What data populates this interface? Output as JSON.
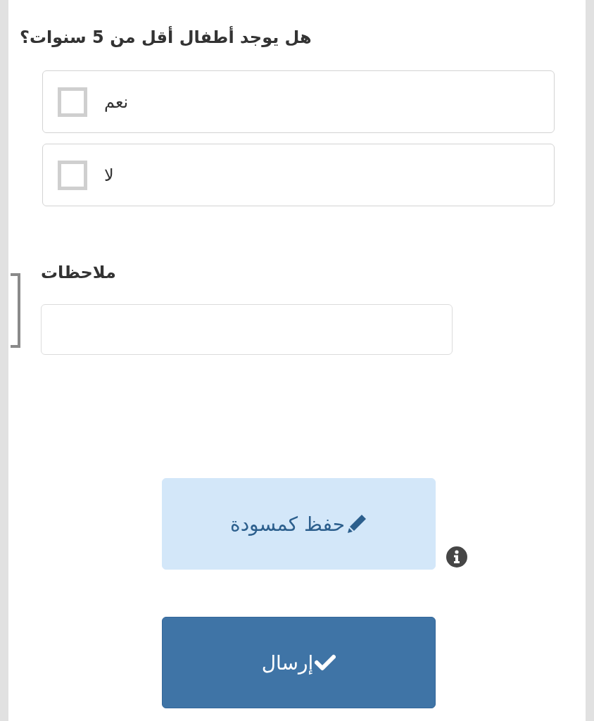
{
  "question": {
    "text": "هل يوجد أطفال أقل من 5 سنوات؟",
    "options": [
      {
        "label": "نعم",
        "checked": false
      },
      {
        "label": "لا",
        "checked": false
      }
    ]
  },
  "notes": {
    "label": "ملاحظات"
  },
  "buttons": [
    {
      "kind": "draft",
      "label": "حفظ كمسودة"
    },
    {
      "kind": "submit",
      "label": "إرسال"
    }
  ]
}
